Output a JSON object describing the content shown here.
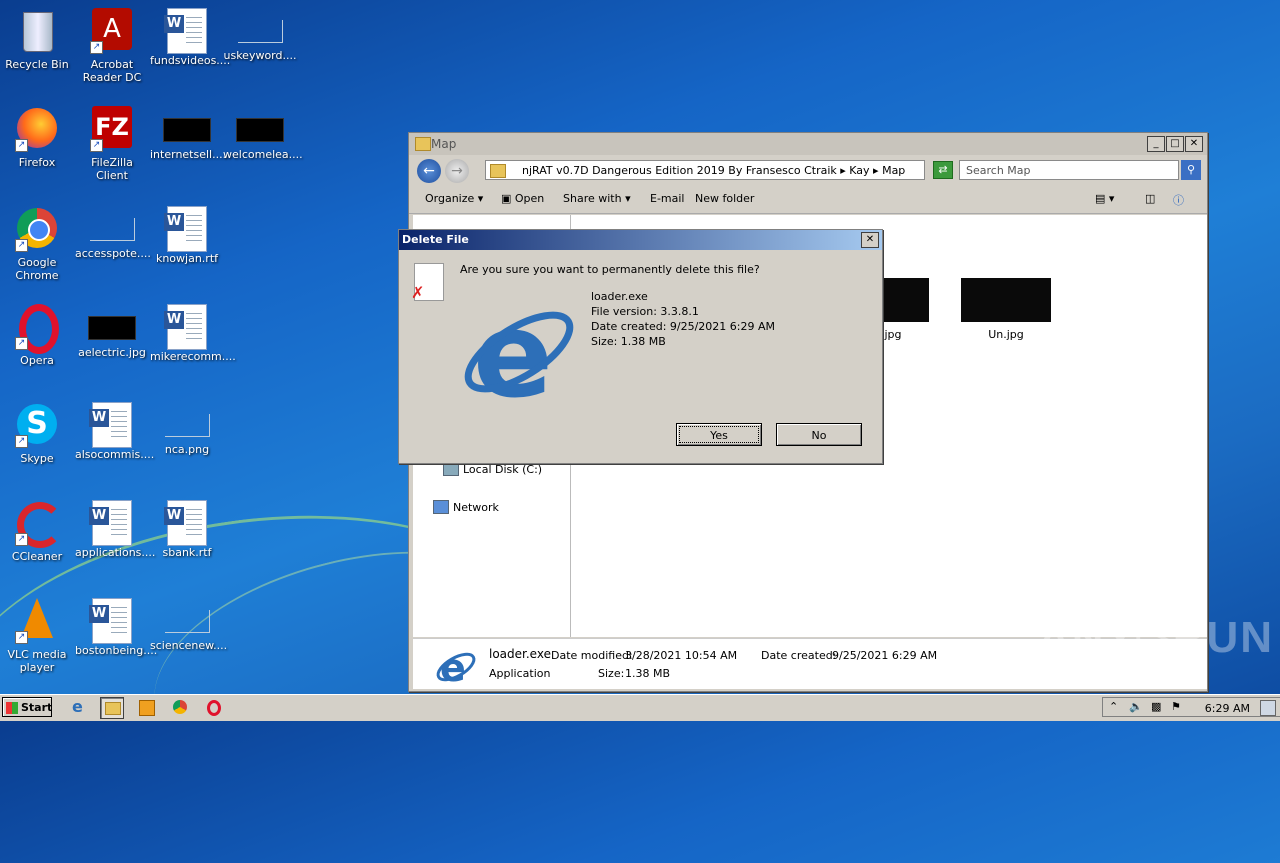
{
  "desktop": {
    "icons": [
      {
        "label": "Recycle Bin",
        "label2": ""
      },
      {
        "label": "Acrobat",
        "label2": "Reader DC"
      },
      {
        "label": "fundsvideos....",
        "label2": ""
      },
      {
        "label": "uskeyword....",
        "label2": ""
      },
      {
        "label": "Firefox",
        "label2": ""
      },
      {
        "label": "FileZilla Client",
        "label2": ""
      },
      {
        "label": "internetsell....",
        "label2": ""
      },
      {
        "label": "welcomelea....",
        "label2": ""
      },
      {
        "label": "Google",
        "label2": "Chrome"
      },
      {
        "label": "accesspote....",
        "label2": ""
      },
      {
        "label": "knowjan.rtf",
        "label2": ""
      },
      {
        "label": "Opera",
        "label2": ""
      },
      {
        "label": "aelectric.jpg",
        "label2": ""
      },
      {
        "label": "mikerecomm....",
        "label2": ""
      },
      {
        "label": "Skype",
        "label2": ""
      },
      {
        "label": "alsocommis....",
        "label2": ""
      },
      {
        "label": "nca.png",
        "label2": ""
      },
      {
        "label": "CCleaner",
        "label2": ""
      },
      {
        "label": "applications....",
        "label2": ""
      },
      {
        "label": "sbank.rtf",
        "label2": ""
      },
      {
        "label": "VLC media",
        "label2": "player"
      },
      {
        "label": "bostonbeing....",
        "label2": ""
      },
      {
        "label": "sciencenew....",
        "label2": ""
      }
    ]
  },
  "explorer": {
    "title": "Map",
    "address": "njRAT v0.7D Dangerous Edition 2019 By Fransesco Ctraik  ▸  Kay  ▸  Map",
    "search_placeholder": "Search Map",
    "toolbar": {
      "organize": "Organize",
      "open": "Open",
      "share_with": "Share with",
      "email": "E-mail",
      "new_folder": "New folder"
    },
    "nav": {
      "local_disk": "Local Disk (C:)",
      "network": "Network"
    },
    "files": [
      {
        "name": "jpg"
      },
      {
        "name": "Un.jpg"
      }
    ],
    "details": {
      "name": "loader.exe",
      "type": "Application",
      "modified_label": "Date modified:",
      "modified": "3/28/2021 10:54 AM",
      "size_label": "Size:",
      "size": "1.38 MB",
      "created_label": "Date created:",
      "created": "9/25/2021 6:29 AM"
    }
  },
  "dialog": {
    "title": "Delete File",
    "question": "Are you sure you want to permanently delete this file?",
    "file_name": "loader.exe",
    "file_version": "File version: 3.3.8.1",
    "date_created": "Date created: 9/25/2021 6:29 AM",
    "size": "Size: 1.38 MB",
    "yes": "Yes",
    "no": "No"
  },
  "taskbar": {
    "start": "Start",
    "clock": "6:29 AM"
  },
  "watermark": "ANY▷RUN"
}
